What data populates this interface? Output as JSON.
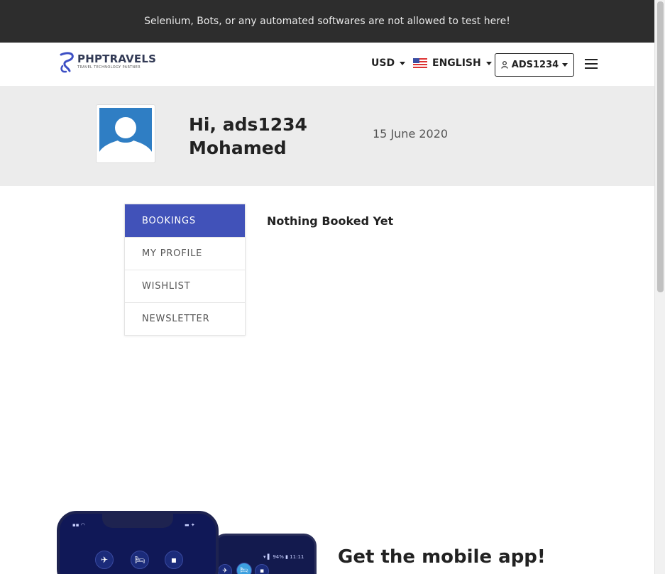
{
  "notice": {
    "text": "Selenium, Bots, or any automated softwares are not allowed to test here!"
  },
  "header": {
    "logo_text": "PHPTRAVELS",
    "logo_tagline": "TRAVEL TECHNOLOGY PARTNER",
    "currency": "USD",
    "language": "ENGLISH",
    "account": "ADS1234",
    "icons": {
      "user": "user-icon",
      "menu": "hamburger-menu-icon",
      "flag": "us-flag-icon",
      "logo": "phptravels-logo-icon"
    }
  },
  "profile": {
    "greeting_line1": "Hi, ads1234",
    "greeting_line2": "Mohamed",
    "date": "15 June 2020",
    "avatar": "default-avatar-icon"
  },
  "sidebar": {
    "items": [
      {
        "label": "BOOKINGS",
        "active": true
      },
      {
        "label": "MY PROFILE",
        "active": false
      },
      {
        "label": "WISHLIST",
        "active": false
      },
      {
        "label": "NEWSLETTER",
        "active": false
      }
    ]
  },
  "main": {
    "empty_message": "Nothing Booked Yet"
  },
  "promo": {
    "title": "Get the mobile app!"
  },
  "colors": {
    "accent": "#4152b9",
    "topbar": "#2d2d2d",
    "band": "#ececec"
  }
}
